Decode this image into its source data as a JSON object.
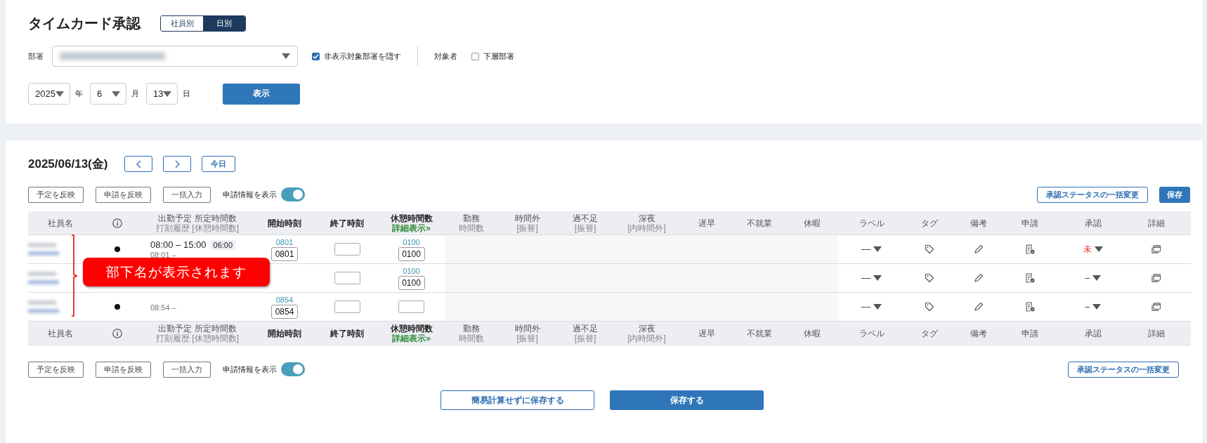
{
  "page_title": "タイムカード承認",
  "view_tabs": [
    {
      "label": "社員別",
      "selected": false
    },
    {
      "label": "日別",
      "selected": true
    }
  ],
  "filters": {
    "department_label": "部署",
    "hide_hidden": {
      "label": "非表示対象部署を隠す",
      "checked": true
    },
    "target_label": "対象者",
    "sub_departments": {
      "label": "下層部署",
      "checked": false
    }
  },
  "date_fields": [
    {
      "value": "2025",
      "unit": "年"
    },
    {
      "value": "6",
      "unit": "月"
    },
    {
      "value": "13",
      "unit": "日"
    }
  ],
  "show_button": "表示",
  "day": {
    "date": "2025/06/13(金)",
    "today_button": "今日"
  },
  "toolbar": {
    "buttons": [
      "予定を反映",
      "申請を反映",
      "一括入力"
    ],
    "toggle": {
      "label": "申請情報を表示",
      "on": true
    },
    "bulk_status_button": "承認ステータスの一括変更",
    "save_button": "保存"
  },
  "table": {
    "columns": [
      {
        "kind": "text",
        "lines": [
          "社員名"
        ],
        "emphasized": false
      },
      {
        "kind": "info"
      },
      {
        "kind": "text",
        "lines": [
          "出勤予定 所定時間数",
          "打刻履歴 [休憩時間数]"
        ],
        "emphasized": false
      },
      {
        "kind": "text",
        "lines": [
          "開始時刻"
        ],
        "emphasized": true
      },
      {
        "kind": "text",
        "lines": [
          "終了時刻"
        ],
        "emphasized": true
      },
      {
        "kind": "text",
        "lines": [
          "休憩時間数"
        ],
        "emphasized": true,
        "link": "詳細表示»"
      },
      {
        "kind": "text",
        "lines": [
          "勤務",
          "時間数"
        ],
        "emphasized": false
      },
      {
        "kind": "text",
        "lines": [
          "時間外",
          "[振替]"
        ],
        "emphasized": false
      },
      {
        "kind": "text",
        "lines": [
          "過不足",
          "[振替]"
        ],
        "emphasized": false
      },
      {
        "kind": "text",
        "lines": [
          "深夜",
          "[内時間外]"
        ],
        "emphasized": false
      },
      {
        "kind": "text",
        "lines": [
          "遅早"
        ],
        "emphasized": false
      },
      {
        "kind": "text",
        "lines": [
          "不就業"
        ],
        "emphasized": false
      },
      {
        "kind": "text",
        "lines": [
          "休暇"
        ],
        "emphasized": false
      },
      {
        "kind": "text",
        "lines": [
          "ラベル"
        ],
        "emphasized": false
      },
      {
        "kind": "text",
        "lines": [
          "タグ"
        ],
        "emphasized": false
      },
      {
        "kind": "text",
        "lines": [
          "備考"
        ],
        "emphasized": false
      },
      {
        "kind": "text",
        "lines": [
          "申請"
        ],
        "emphasized": false
      },
      {
        "kind": "text",
        "lines": [
          "承認"
        ],
        "emphasized": false
      },
      {
        "kind": "text",
        "lines": [
          "詳細"
        ],
        "emphasized": false
      }
    ],
    "rows": [
      {
        "plan": "08:00 – 15:00",
        "plan_hours": "06:00",
        "history": "08:01 –",
        "start_link": "0801",
        "start_value": "0801",
        "break_link": "0100",
        "break_value": "0100",
        "label": "––",
        "approval": "未",
        "approval_pending": true
      },
      {
        "break_link": "0100",
        "break_value": "0100",
        "label": "––",
        "approval": "–",
        "approval_pending": false
      },
      {
        "history": "08:54 –",
        "start_link": "0854",
        "start_value": "0854",
        "label": "––",
        "approval": "–",
        "approval_pending": false
      }
    ],
    "footer_columns": [
      {
        "kind": "text",
        "lines": [
          "社員名"
        ],
        "emphasized": false
      },
      {
        "kind": "info"
      },
      {
        "kind": "text",
        "lines": [
          "出勤予定 所定時間数",
          "打刻履歴 [休憩時間数]"
        ],
        "emphasized": false
      },
      {
        "kind": "text",
        "lines": [
          "開始時刻"
        ],
        "emphasized": true
      },
      {
        "kind": "text",
        "lines": [
          "終了時刻"
        ],
        "emphasized": true
      },
      {
        "kind": "text",
        "lines": [
          "休憩時間数"
        ],
        "emphasized": true,
        "link": "詳細表示»"
      },
      {
        "kind": "text",
        "lines": [
          "勤務",
          "時間数"
        ],
        "emphasized": false
      },
      {
        "kind": "text",
        "lines": [
          "時間外",
          "[振替]"
        ],
        "emphasized": false
      },
      {
        "kind": "text",
        "lines": [
          "過不足",
          "[振替]"
        ],
        "emphasized": false
      },
      {
        "kind": "text",
        "lines": [
          "深夜",
          "[内時間外]"
        ],
        "emphasized": false
      },
      {
        "kind": "text",
        "lines": [
          "遅早"
        ],
        "emphasized": false
      },
      {
        "kind": "text",
        "lines": [
          "不就業"
        ],
        "emphasized": false
      },
      {
        "kind": "text",
        "lines": [
          "休暇"
        ],
        "emphasized": false
      },
      {
        "kind": "text",
        "lines": [
          "ラベル"
        ],
        "emphasized": false
      },
      {
        "kind": "text",
        "lines": [
          "タグ"
        ],
        "emphasized": false
      },
      {
        "kind": "text",
        "lines": [
          "備考"
        ],
        "emphasized": false
      },
      {
        "kind": "text",
        "lines": [
          "申請"
        ],
        "emphasized": false
      },
      {
        "kind": "text",
        "lines": [
          "承認"
        ],
        "emphasized": false
      },
      {
        "kind": "text",
        "lines": [
          "詳細"
        ],
        "emphasized": false
      }
    ]
  },
  "callout": "部下名が表示されます",
  "bottom_toolbar": {
    "buttons": [
      "予定を反映",
      "申請を反映",
      "一括入力"
    ],
    "toggle": {
      "label": "申請情報を表示",
      "on": true
    },
    "bulk_status_button": "承認ステータスの一括変更"
  },
  "actions": {
    "save_without_calc": "簡易計算せずに保存する",
    "save": "保存する"
  }
}
